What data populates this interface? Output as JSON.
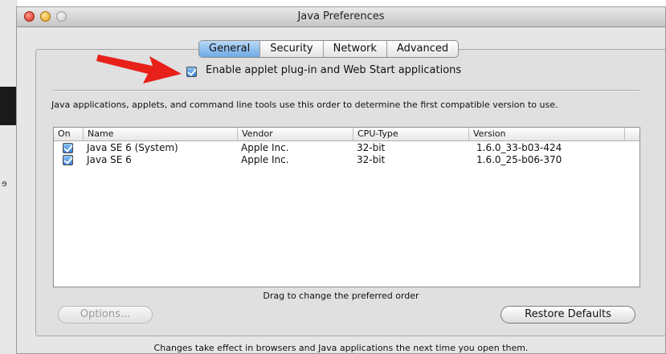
{
  "window": {
    "title": "Java Preferences"
  },
  "tabs": [
    {
      "label": "General",
      "active": true
    },
    {
      "label": "Security",
      "active": false
    },
    {
      "label": "Network",
      "active": false
    },
    {
      "label": "Advanced",
      "active": false
    }
  ],
  "general": {
    "enable_label": "Enable applet plug-in and Web Start applications",
    "enable_checked": true,
    "description": "Java applications, applets, and command line tools use this order to determine the first compatible version to use."
  },
  "table": {
    "headers": {
      "on": "On",
      "name": "Name",
      "vendor": "Vendor",
      "cpu_type": "CPU-Type",
      "version": "Version"
    },
    "rows": [
      {
        "checked": true,
        "name": "Java SE 6 (System)",
        "vendor": "Apple Inc.",
        "cpu_type": "32-bit",
        "version": "1.6.0_33-b03-424"
      },
      {
        "checked": true,
        "name": "Java SE 6",
        "vendor": "Apple Inc.",
        "cpu_type": "32-bit",
        "version": "1.6.0_25-b06-370"
      }
    ]
  },
  "drag_hint": "Drag to change the preferred order",
  "buttons": {
    "options": "Options...",
    "options_enabled": false,
    "restore_defaults": "Restore Defaults"
  },
  "footer_note": "Changes take effect in browsers and Java applications the next time you open them.",
  "annotation": {
    "arrow_color": "#e8201a",
    "stray_text": "ɘ"
  },
  "colors": {
    "selected_tab": "#6ea9e6",
    "checkbox": "#3a7fd6"
  }
}
